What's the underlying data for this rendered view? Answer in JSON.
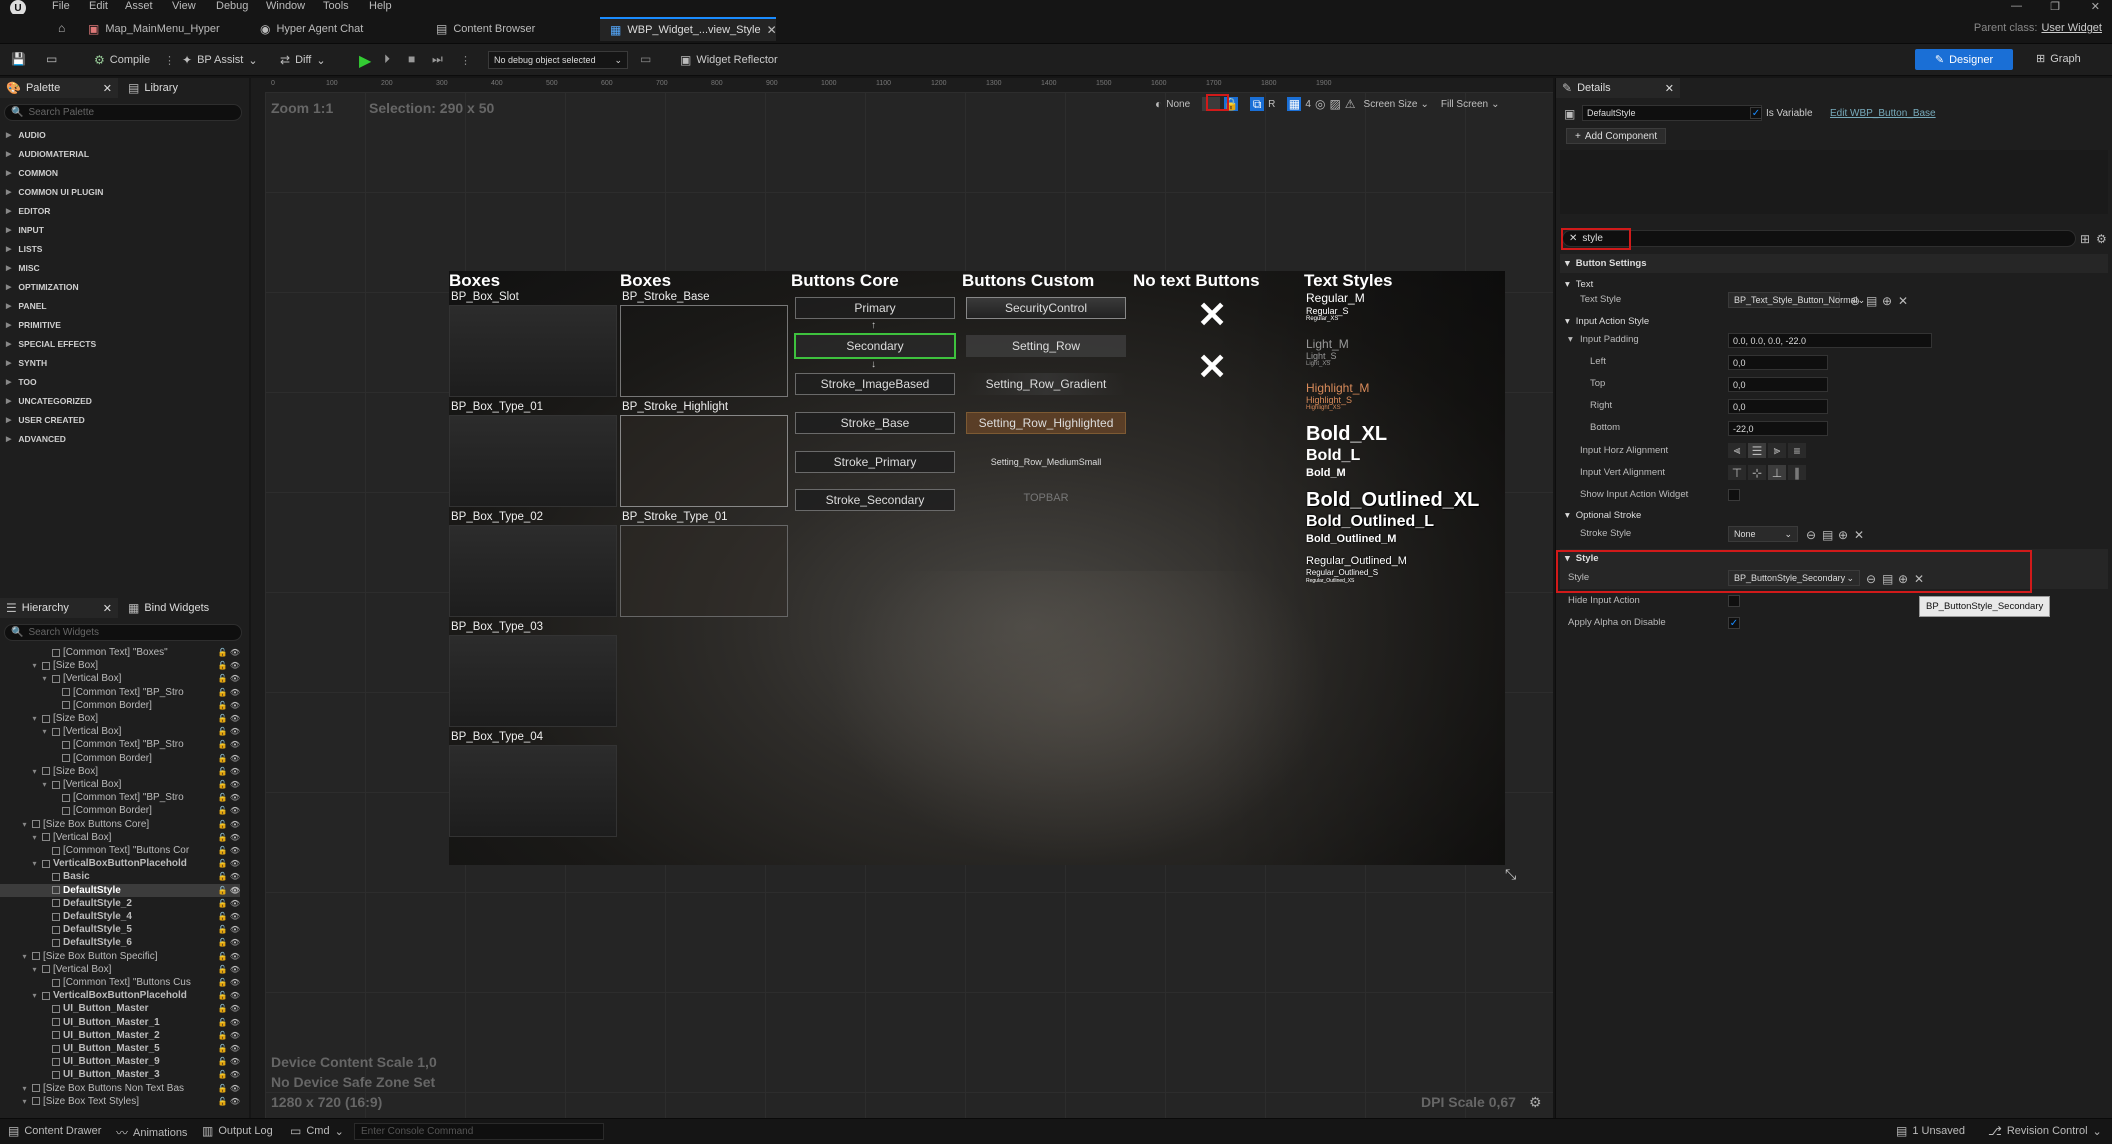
{
  "menu": [
    "File",
    "Edit",
    "Asset",
    "View",
    "Debug",
    "Window",
    "Tools",
    "Help"
  ],
  "tabs": [
    {
      "label": "Map_MainMenu_Hyper",
      "icon": "map-icon"
    },
    {
      "label": "Hyper Agent Chat",
      "icon": "chat-icon"
    },
    {
      "label": "Content Browser",
      "icon": "folder-icon"
    },
    {
      "label": "WBP_Widget_...view_Style",
      "icon": "widget-icon",
      "active": true
    }
  ],
  "parent_class": {
    "label": "Parent class:",
    "value": "User Widget"
  },
  "toolbar": {
    "compile": "Compile",
    "bp_assist": "BP Assist",
    "diff": "Diff",
    "debug_object": "No debug object selected",
    "widget_reflector": "Widget Reflector",
    "designer": "Designer",
    "graph": "Graph"
  },
  "palette": {
    "tab": "Palette",
    "library_tab": "Library",
    "search_placeholder": "Search Palette",
    "categories": [
      "AUDIO",
      "AUDIOMATERIAL",
      "COMMON",
      "COMMON UI PLUGIN",
      "EDITOR",
      "INPUT",
      "LISTS",
      "MISC",
      "OPTIMIZATION",
      "PANEL",
      "PRIMITIVE",
      "SPECIAL EFFECTS",
      "SYNTH",
      "TOO",
      "UNCATEGORIZED",
      "USER CREATED",
      "ADVANCED"
    ]
  },
  "hierarchy": {
    "tab": "Hierarchy",
    "bind_tab": "Bind Widgets",
    "search_placeholder": "Search Widgets",
    "rows": [
      {
        "indent": 4,
        "text": "[Common Text] \"Boxes\""
      },
      {
        "indent": 3,
        "text": "[Size Box]"
      },
      {
        "indent": 4,
        "text": "[Vertical Box]"
      },
      {
        "indent": 5,
        "text": "[Common Text] \"BP_Stro"
      },
      {
        "indent": 5,
        "text": "[Common Border]"
      },
      {
        "indent": 3,
        "text": "[Size Box]"
      },
      {
        "indent": 4,
        "text": "[Vertical Box]"
      },
      {
        "indent": 5,
        "text": "[Common Text] \"BP_Stro"
      },
      {
        "indent": 5,
        "text": "[Common Border]"
      },
      {
        "indent": 3,
        "text": "[Size Box]"
      },
      {
        "indent": 4,
        "text": "[Vertical Box]"
      },
      {
        "indent": 5,
        "text": "[Common Text] \"BP_Stro"
      },
      {
        "indent": 5,
        "text": "[Common Border]"
      },
      {
        "indent": 2,
        "text": "[Size Box Buttons Core]"
      },
      {
        "indent": 3,
        "text": "[Vertical Box]"
      },
      {
        "indent": 4,
        "text": "[Common Text] \"Buttons Cor"
      },
      {
        "indent": 3,
        "text": "VerticalBoxButtonPlacehold",
        "bold": true
      },
      {
        "indent": 4,
        "text": "Basic",
        "bold": true
      },
      {
        "indent": 4,
        "text": "DefaultStyle",
        "bold": true,
        "selected": true
      },
      {
        "indent": 4,
        "text": "DefaultStyle_2",
        "bold": true
      },
      {
        "indent": 4,
        "text": "DefaultStyle_4",
        "bold": true
      },
      {
        "indent": 4,
        "text": "DefaultStyle_5",
        "bold": true
      },
      {
        "indent": 4,
        "text": "DefaultStyle_6",
        "bold": true
      },
      {
        "indent": 2,
        "text": "[Size Box Button Specific]"
      },
      {
        "indent": 3,
        "text": "[Vertical Box]"
      },
      {
        "indent": 4,
        "text": "[Common Text] \"Buttons Cus"
      },
      {
        "indent": 3,
        "text": "VerticalBoxButtonPlacehold",
        "bold": true
      },
      {
        "indent": 4,
        "text": "UI_Button_Master",
        "bold": true
      },
      {
        "indent": 4,
        "text": "UI_Button_Master_1",
        "bold": true
      },
      {
        "indent": 4,
        "text": "UI_Button_Master_2",
        "bold": true
      },
      {
        "indent": 4,
        "text": "UI_Button_Master_5",
        "bold": true
      },
      {
        "indent": 4,
        "text": "UI_Button_Master_9",
        "bold": true
      },
      {
        "indent": 4,
        "text": "UI_Button_Master_3",
        "bold": true
      },
      {
        "indent": 2,
        "text": "[Size Box Buttons Non Text Bas"
      },
      {
        "indent": 2,
        "text": "[Size Box Text Styles]"
      }
    ]
  },
  "viewport": {
    "zoom": "Zoom 1:1",
    "selection": "Selection: 290 x 50",
    "none_label": "None",
    "r_label": "R",
    "grid_num": "4",
    "screen_size": "Screen Size",
    "fill_screen": "Fill Screen",
    "device_scale": "Device Content Scale 1,0",
    "safe_zone": "No Device Safe Zone Set",
    "resolution": "1280 x 720 (16:9)",
    "dpi": "DPI Scale 0,67",
    "ruler_ticks": [
      "0",
      "100",
      "200",
      "300",
      "400",
      "500",
      "600",
      "700",
      "800",
      "900",
      "1000",
      "1100",
      "1200",
      "1300",
      "1400",
      "1500",
      "1600",
      "1700",
      "1800",
      "1900"
    ]
  },
  "canvas": {
    "col_boxes1": "Boxes",
    "col_boxes2": "Boxes",
    "col_buttons_core": "Buttons Core",
    "col_buttons_custom": "Buttons Custom",
    "col_no_text": "No text Buttons",
    "col_text_styles": "Text Styles",
    "boxes1": [
      "BP_Box_Slot",
      "BP_Box_Type_01",
      "BP_Box_Type_02",
      "BP_Box_Type_03",
      "BP_Box_Type_04"
    ],
    "boxes2": [
      "BP_Stroke_Base",
      "BP_Stroke_Highlight",
      "BP_Stroke_Type_01"
    ],
    "core_buttons": [
      "Primary",
      "Secondary",
      "Stroke_ImageBased",
      "Stroke_Base",
      "Stroke_Primary",
      "Stroke_Secondary"
    ],
    "custom_buttons": [
      "SecurityControl",
      "Setting_Row",
      "Setting_Row_Gradient",
      "Setting_Row_Highlighted",
      "Setting_Row_MediumSmall",
      "TOPBAR"
    ],
    "text_styles": {
      "regular_m": "Regular_M",
      "regular_s": "Regular_S",
      "regular_xs": "Regular_XS",
      "light_m": "Light_M",
      "light_s": "Light_S",
      "light_xs": "Light_XS",
      "highlight_m": "Highlight_M",
      "highlight_s": "Highlight_S",
      "highlight_xs": "Highlight_XS",
      "bold_xl": "Bold_XL",
      "bold_l": "Bold_L",
      "bold_m": "Bold_M",
      "bold_outlined_xl": "Bold_Outlined_XL",
      "bold_outlined_l": "Bold_Outlined_L",
      "bold_outlined_m": "Bold_Outlined_M",
      "regular_outlined_m": "Regular_Outlined_M",
      "regular_outlined_s": "Regular_Outlined_S",
      "regular_outlined_xs": "Regular_Outlined_XS"
    }
  },
  "details": {
    "tab": "Details",
    "name": "DefaultStyle",
    "is_variable": "Is Variable",
    "edit_link": "Edit WBP_Button_Base",
    "add_component": "Add Component",
    "search_value": "style",
    "section_button_settings": "Button Settings",
    "section_text": "Text",
    "text_style_label": "Text Style",
    "text_style_value": "BP_Text_Style_Button_Normal",
    "section_input_action_style": "Input Action Style",
    "input_padding_label": "Input Padding",
    "input_padding_value": "0.0, 0.0, 0.0, -22.0",
    "left_label": "Left",
    "left_value": "0,0",
    "top_label": "Top",
    "top_value": "0,0",
    "right_label": "Right",
    "right_value": "0,0",
    "bottom_label": "Bottom",
    "bottom_value": "-22,0",
    "horz_align_label": "Input Horz Alignment",
    "vert_align_label": "Input Vert Alignment",
    "show_input_action_label": "Show Input Action Widget",
    "section_optional_stroke": "Optional Stroke",
    "stroke_style_label": "Stroke Style",
    "stroke_style_value": "None",
    "section_style": "Style",
    "style_label": "Style",
    "style_value": "BP_ButtonStyle_Secondary",
    "tooltip": "BP_ButtonStyle_Secondary",
    "hide_input_action_label": "Hide Input Action",
    "apply_alpha_label": "Apply Alpha on Disable"
  },
  "statusbar": {
    "content_drawer": "Content Drawer",
    "animations": "Animations",
    "output_log": "Output Log",
    "cmd": "Cmd",
    "console_placeholder": "Enter Console Command",
    "unsaved": "1 Unsaved",
    "revision": "Revision Control"
  },
  "colors": {
    "accent": "#1a8cff",
    "highlight_red": "#d11a1a",
    "selected_green": "#3ec23e"
  }
}
